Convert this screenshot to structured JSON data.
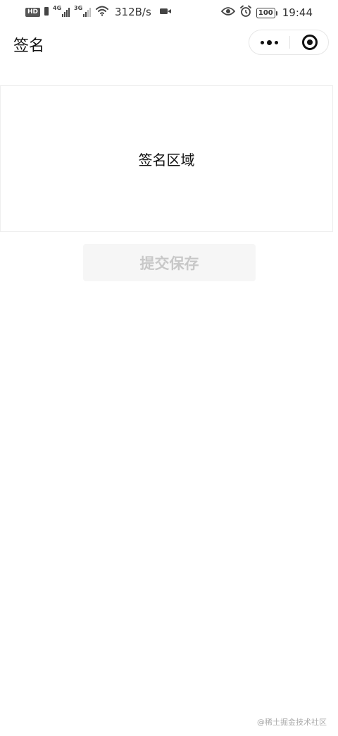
{
  "status_bar": {
    "hd_label": "HD",
    "sim1_gen": "4G",
    "sim2_gen": "3G",
    "net_speed": "312B/s",
    "battery_level": "100",
    "time": "19:44"
  },
  "nav": {
    "title": "签名"
  },
  "signature": {
    "label": "签名区域"
  },
  "submit": {
    "label": "提交保存"
  },
  "watermark": {
    "text": "@稀土掘金技术社区"
  }
}
